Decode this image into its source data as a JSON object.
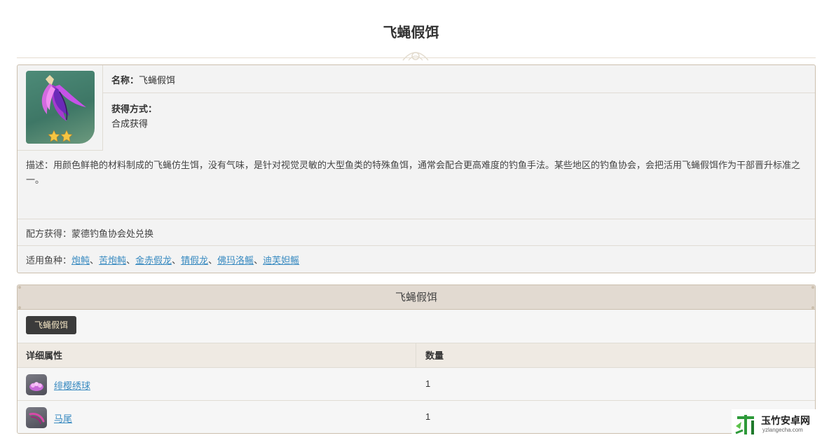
{
  "page": {
    "title": "飞蝇假饵"
  },
  "item": {
    "name_label": "名称：",
    "name": "飞蝇假饵",
    "acquire_label": "获得方式：",
    "acquire_value": "合成获得",
    "rarity_stars": 2,
    "description": "描述：用颜色鲜艳的材料制成的飞蝇仿生饵，没有气味，是针对视觉灵敏的大型鱼类的特殊鱼饵，通常会配合更高难度的钓鱼手法。某些地区的钓鱼协会，会把活用飞蝇假饵作为干部晋升标准之一。",
    "recipe": "配方获得：蒙德钓鱼协会处兑换",
    "fish_label": "适用鱼种：",
    "fish": [
      "炮鲀",
      "苦炮鲀",
      "金赤假龙",
      "锖假龙",
      "佛玛洛鳐",
      "迪芙妲鳐"
    ],
    "fish_separator": "、"
  },
  "craft": {
    "header": "飞蝇假饵",
    "tab_label": "飞蝇假饵",
    "columns": [
      "详细属性",
      "数量"
    ],
    "rows": [
      {
        "name": "绯樱绣球",
        "qty": "1",
        "icon": "sakura-bloom-icon"
      },
      {
        "name": "马尾",
        "qty": "1",
        "icon": "horsetail-icon"
      }
    ]
  },
  "watermark": {
    "title": "玉竹安卓网",
    "subtitle": "yzlangecha.com"
  },
  "colors": {
    "link": "#3a8bc1",
    "border": "#cbbfae",
    "header_bg": "#e2dad1",
    "tab_bg": "#3b3b3b",
    "star": "#f5c542"
  }
}
